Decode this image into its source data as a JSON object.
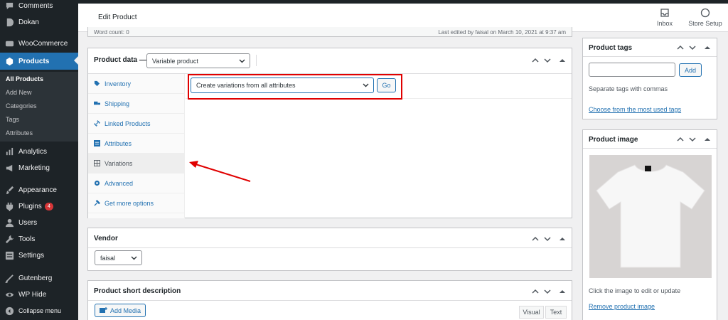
{
  "sidebar": {
    "items": [
      {
        "label": "Comments",
        "icon": "comment-icon"
      },
      {
        "label": "Dokan",
        "icon": "dokan-icon"
      },
      {
        "label": "WooCommerce",
        "icon": "woocommerce-icon"
      },
      {
        "label": "Products",
        "icon": "products-icon"
      },
      {
        "label": "Analytics",
        "icon": "analytics-icon"
      },
      {
        "label": "Marketing",
        "icon": "megaphone-icon"
      },
      {
        "label": "Appearance",
        "icon": "paintbrush-icon"
      },
      {
        "label": "Plugins",
        "icon": "plugin-icon",
        "badge": "4"
      },
      {
        "label": "Users",
        "icon": "user-icon"
      },
      {
        "label": "Tools",
        "icon": "wrench-icon"
      },
      {
        "label": "Settings",
        "icon": "settings-icon"
      },
      {
        "label": "Gutenberg",
        "icon": "gutenberg-icon"
      },
      {
        "label": "WP Hide",
        "icon": "eye-icon"
      },
      {
        "label": "Collapse menu",
        "icon": "collapse-icon"
      }
    ],
    "submenu": [
      "All Products",
      "Add New",
      "Categories",
      "Tags",
      "Attributes"
    ]
  },
  "header": {
    "title": "Edit Product",
    "inbox_label": "Inbox",
    "store_setup_label": "Store Setup"
  },
  "editor_status": {
    "word_count": "Word count: 0",
    "last_edited": "Last edited by faisal on March 10, 2021 at 9:37 am"
  },
  "product_data": {
    "title": "Product data —",
    "type_selected": "Variable product",
    "tabs": [
      {
        "label": "Inventory",
        "icon": "tag-icon"
      },
      {
        "label": "Shipping",
        "icon": "truck-icon"
      },
      {
        "label": "Linked Products",
        "icon": "link-icon"
      },
      {
        "label": "Attributes",
        "icon": "list-icon"
      },
      {
        "label": "Variations",
        "icon": "grid-icon"
      },
      {
        "label": "Advanced",
        "icon": "gear-icon"
      },
      {
        "label": "Get more options",
        "icon": "plugin-icon"
      }
    ],
    "variation_action": "Create variations from all attributes",
    "go_label": "Go"
  },
  "vendor": {
    "title": "Vendor",
    "selected": "faisal"
  },
  "short_description": {
    "title": "Product short description",
    "add_media": "Add Media",
    "visual_tab": "Visual",
    "text_tab": "Text"
  },
  "product_tags": {
    "title": "Product tags",
    "add_label": "Add",
    "hint": "Separate tags with commas",
    "choose_link": "Choose from the most used tags"
  },
  "product_image": {
    "title": "Product image",
    "hint": "Click the image to edit or update",
    "remove_link": "Remove product image"
  },
  "colors": {
    "accent": "#2271b1",
    "sidebar_bg": "#1d2327",
    "annotation_red": "#e00000"
  }
}
